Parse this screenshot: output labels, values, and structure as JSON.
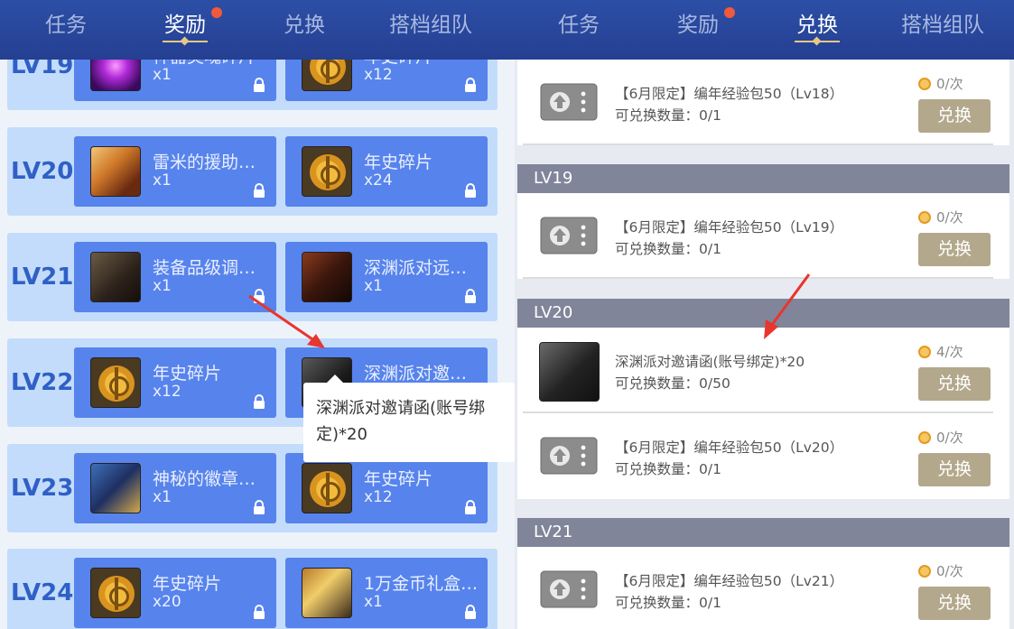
{
  "left": {
    "tabs": [
      {
        "label": "任务",
        "active": false
      },
      {
        "label": "奖励",
        "active": true,
        "badge": true
      },
      {
        "label": "兑换",
        "active": false
      },
      {
        "label": "搭档组队",
        "active": false
      }
    ],
    "rows": [
      {
        "level": "LV19",
        "cards": [
          {
            "name": "神器灵魂碎片",
            "qty": "x1",
            "icon": "purple-orb-icon"
          },
          {
            "name": "年史碎片",
            "qty": "x12",
            "icon": "coin-icon"
          }
        ]
      },
      {
        "level": "LV20",
        "cards": [
          {
            "name": "雷米的援助礼盒",
            "qty": "x1",
            "icon": "hand-icon"
          },
          {
            "name": "年史碎片",
            "qty": "x24",
            "icon": "coin-icon"
          }
        ]
      },
      {
        "level": "LV21",
        "cards": [
          {
            "name": "装备品级调整箱",
            "qty": "x1",
            "icon": "cube-icon"
          },
          {
            "name": "深渊派对远古卷轴",
            "qty": "x1",
            "icon": "book-icon"
          }
        ]
      },
      {
        "level": "LV22",
        "cards": [
          {
            "name": "年史碎片",
            "qty": "x12",
            "icon": "coin-icon"
          },
          {
            "name": "深渊派对邀请函",
            "qty": "x20",
            "icon": "card-icon"
          }
        ]
      },
      {
        "level": "LV23",
        "cards": [
          {
            "name": "神秘的徽章礼盒",
            "qty": "x1",
            "icon": "box-icon"
          },
          {
            "name": "年史碎片",
            "qty": "x12",
            "icon": "coin-icon"
          }
        ]
      },
      {
        "level": "LV24",
        "cards": [
          {
            "name": "年史碎片",
            "qty": "x20",
            "icon": "coin-icon"
          },
          {
            "name": "1万金币礼盒（可交易）",
            "qty": "x1",
            "icon": "chest-icon"
          }
        ]
      }
    ],
    "tooltip": "深渊派对邀请函(账号绑定)*20"
  },
  "right": {
    "tabs": [
      {
        "label": "任务",
        "active": false
      },
      {
        "label": "奖励",
        "active": false,
        "badge": true
      },
      {
        "label": "兑换",
        "active": true
      },
      {
        "label": "搭档组队",
        "active": false
      }
    ],
    "top_item": {
      "title": "【6月限定】编年经验包50（Lv18）",
      "limit": "可兑换数量：0/1",
      "cost": "0/次",
      "button": "兑换"
    },
    "sections": [
      {
        "header": "LV19",
        "items": [
          {
            "title": "【6月限定】编年经验包50（Lv19）",
            "limit": "可兑换数量：0/1",
            "cost": "0/次",
            "button": "兑换"
          }
        ]
      },
      {
        "header": "LV20",
        "items": [
          {
            "title": "深渊派对邀请函(账号绑定)*20",
            "limit": "可兑换数量：0/50",
            "cost": "4/次",
            "button": "兑换"
          },
          {
            "title": "【6月限定】编年经验包50（Lv20）",
            "limit": "可兑换数量：0/1",
            "cost": "0/次",
            "button": "兑换"
          }
        ]
      },
      {
        "header": "LV21",
        "items": [
          {
            "title": "【6月限定】编年经验包50（Lv21）",
            "limit": "可兑换数量：0/1",
            "cost": "0/次",
            "button": "兑换"
          }
        ]
      }
    ]
  },
  "colors": {
    "nav": "#2c4fa6",
    "card": "#5783ec",
    "row": "#c3dcfb",
    "button": "#b3a88c",
    "badge": "#ef5a3c",
    "arrow": "#e8352e"
  }
}
